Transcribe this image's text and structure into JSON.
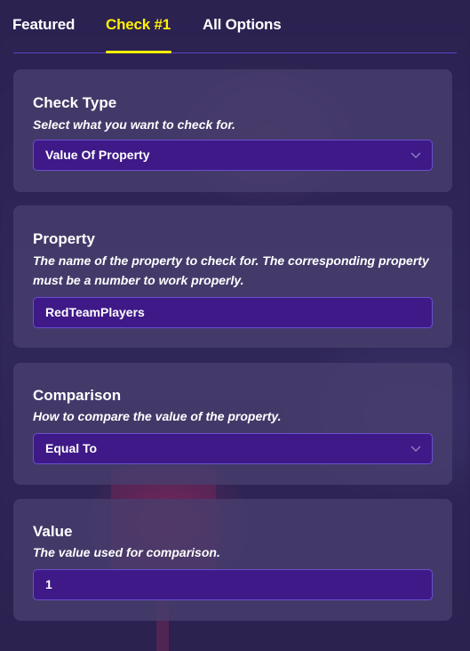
{
  "tabs": [
    {
      "label": "Featured",
      "active": false
    },
    {
      "label": "Check #1",
      "active": true
    },
    {
      "label": "All Options",
      "active": false
    }
  ],
  "colors": {
    "active_tab": "#fff000",
    "field_bg": "#3e1987",
    "card_bg": "#483e6e",
    "page_bg": "#2d2352"
  },
  "check_type": {
    "title": "Check Type",
    "description": "Select what you want to check for.",
    "value": "Value Of Property",
    "icon": "chevron-down-icon"
  },
  "property": {
    "title": "Property",
    "description": "The name of the property to check for. The corresponding property must be a number to work properly.",
    "value": "RedTeamPlayers"
  },
  "comparison": {
    "title": "Comparison",
    "description": "How to compare the value of the property.",
    "value": "Equal To",
    "icon": "chevron-down-icon"
  },
  "value_field": {
    "title": "Value",
    "description": "The value used for comparison.",
    "value": "1"
  }
}
